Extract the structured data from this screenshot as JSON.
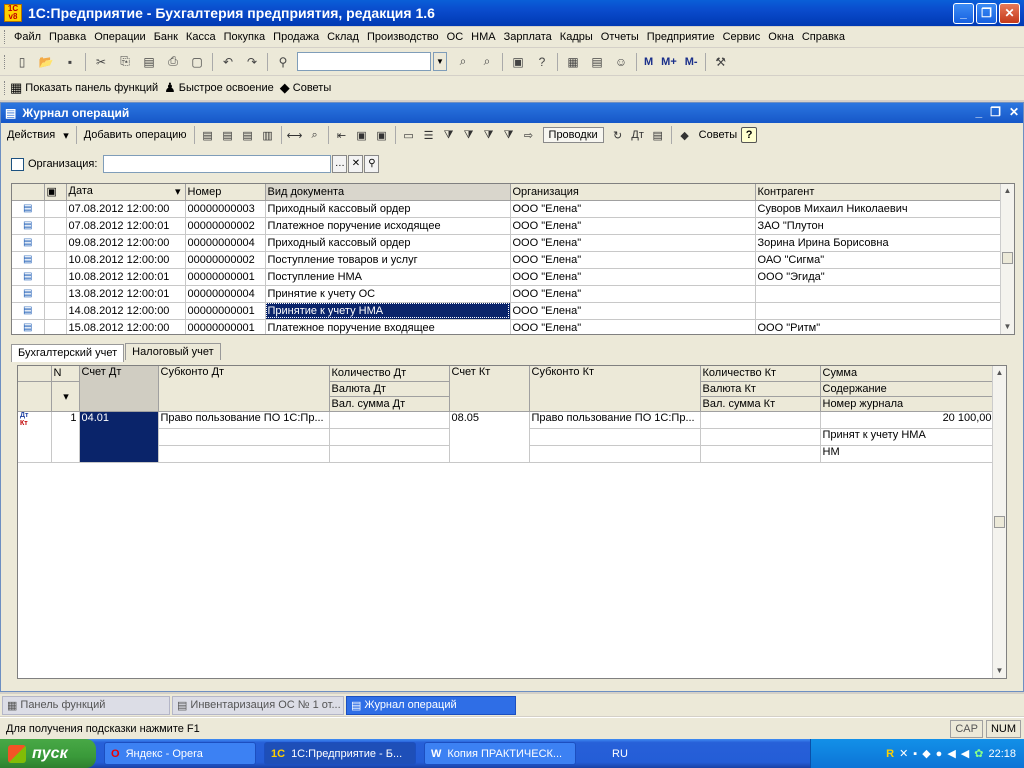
{
  "window": {
    "title": "1С:Предприятие - Бухгалтерия предприятия, редакция 1.6",
    "logo_text": "1С v8"
  },
  "menu": [
    "Файл",
    "Правка",
    "Операции",
    "Банк",
    "Касса",
    "Покупка",
    "Продажа",
    "Склад",
    "Производство",
    "ОС",
    "НМА",
    "Зарплата",
    "Кадры",
    "Отчеты",
    "Предприятие",
    "Сервис",
    "Окна",
    "Справка"
  ],
  "toolbar2": {
    "show_panel": "Показать панель функций",
    "quick_learn": "Быстрое освоение",
    "tips": "Советы"
  },
  "toolbar_m": [
    "M",
    "M+",
    "M-"
  ],
  "journal": {
    "title": "Журнал операций",
    "cmd": {
      "actions": "Действия",
      "add_operation": "Добавить операцию",
      "provodki": "Проводки",
      "tips": "Советы",
      "help": "?"
    },
    "filter_label": "Организация:",
    "columns": [
      "Дата",
      "Номер",
      "Вид документа",
      "Организация",
      "Контрагент"
    ],
    "rows": [
      {
        "date": "07.08.2012 12:00:00",
        "number": "00000000003",
        "doc_type": "Приходный кассовый ордер",
        "org": "ООО \"Елена\"",
        "counterparty": "Суворов Михаил Николаевич"
      },
      {
        "date": "07.08.2012 12:00:01",
        "number": "00000000002",
        "doc_type": "Платежное поручение исходящее",
        "org": "ООО \"Елена\"",
        "counterparty": "ЗАО \"Плутон"
      },
      {
        "date": "09.08.2012 12:00:00",
        "number": "00000000004",
        "doc_type": "Приходный кассовый ордер",
        "org": "ООО \"Елена\"",
        "counterparty": "Зорина Ирина Борисовна"
      },
      {
        "date": "10.08.2012 12:00:00",
        "number": "00000000002",
        "doc_type": "Поступление товаров и услуг",
        "org": "ООО \"Елена\"",
        "counterparty": "ОАО \"Сигма\""
      },
      {
        "date": "10.08.2012 12:00:01",
        "number": "00000000001",
        "doc_type": "Поступление НМА",
        "org": "ООО \"Елена\"",
        "counterparty": "ООО \"Эгида\""
      },
      {
        "date": "13.08.2012 12:00:01",
        "number": "00000000004",
        "doc_type": "Принятие к учету ОС",
        "org": "ООО \"Елена\"",
        "counterparty": ""
      },
      {
        "date": "14.08.2012 12:00:00",
        "number": "00000000001",
        "doc_type": "Принятие к учету НМА",
        "org": "ООО \"Елена\"",
        "counterparty": ""
      },
      {
        "date": "15.08.2012 12:00:00",
        "number": "00000000001",
        "doc_type": "Платежное поручение входящее",
        "org": "ООО \"Елена\"",
        "counterparty": "ООО \"Ритм\""
      }
    ],
    "selected_row": 6
  },
  "tabs": [
    "Бухгалтерский учет",
    "Налоговый учет"
  ],
  "postings": {
    "headers": {
      "n": "N",
      "acc_dt": "Счет Дт",
      "subconto_dt": "Субконто Дт",
      "qty_dt": "Количество Дт",
      "cur_dt": "Валюта Дт",
      "cur_sum_dt": "Вал. сумма Дт",
      "acc_kt": "Счет Кт",
      "subconto_kt": "Субконто Кт",
      "qty_kt": "Количество Кт",
      "cur_kt": "Валюта Кт",
      "cur_sum_kt": "Вал. сумма Кт",
      "sum": "Сумма",
      "content": "Содержание",
      "journal_no": "Номер журнала"
    },
    "rows": [
      {
        "n": "1",
        "acc_dt": "04.01",
        "subconto_dt": "Право пользование ПО 1С:Пр...",
        "acc_kt": "08.05",
        "subconto_kt": "Право пользование ПО 1С:Пр...",
        "sum": "20 100,00",
        "content": "Принят к учету НМА",
        "journal_no": "НМ",
        "icon_dt": "Дт",
        "icon_kt": "Кт"
      }
    ]
  },
  "window_tabs": [
    "Панель функций",
    "Инвентаризация ОС № 1 от...",
    "Журнал операций"
  ],
  "status": {
    "hint": "Для получения подсказки нажмите F1",
    "cap": "CAP",
    "num": "NUM"
  },
  "taskbar": {
    "start": "пуск",
    "tasks": [
      "Яндекс - Opera",
      "1С:Предприятие - Б...",
      "Копия ПРАКТИЧЕСК..."
    ],
    "lang": "RU",
    "clock": "22:18"
  }
}
